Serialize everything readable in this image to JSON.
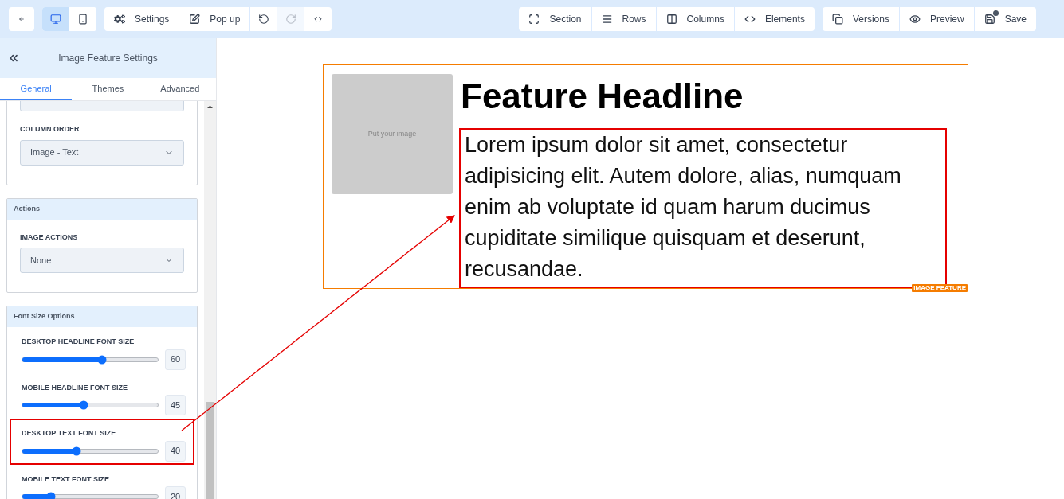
{
  "toolbar": {
    "devices": [
      {
        "selected": true
      },
      {
        "selected": false
      }
    ],
    "actions": [
      "Settings",
      "Pop up"
    ],
    "history": [
      {
        "disabled": false
      },
      {
        "disabled": true
      }
    ],
    "build": [
      "Section",
      "Rows",
      "Columns",
      "Elements"
    ],
    "publish": [
      "Versions",
      "Preview",
      "Save"
    ]
  },
  "sidebar": {
    "title": "Image Feature Settings",
    "tabs": [
      {
        "label": "General",
        "selected": true
      },
      {
        "label": "Themes",
        "selected": false
      },
      {
        "label": "Advanced",
        "selected": false
      }
    ],
    "sections": [
      {
        "fields": [
          {
            "kind": "stub"
          },
          {
            "kind": "select",
            "label": "COLUMN ORDER",
            "value": "Image - Text"
          }
        ]
      },
      {
        "title": "Actions",
        "fields": [
          {
            "kind": "select",
            "label": "IMAGE ACTIONS",
            "value": "None"
          }
        ]
      },
      {
        "title": "Font Size Options",
        "fields": [
          {
            "kind": "slider",
            "label": "DESKTOP HEADLINE FONT SIZE",
            "level": 0.59,
            "value": "60",
            "annotated": false
          },
          {
            "kind": "slider",
            "label": "MOBILE HEADLINE FONT SIZE",
            "level": 0.45,
            "value": "45",
            "annotated": false
          },
          {
            "kind": "slider",
            "label": "DESKTOP TEXT FONT SIZE",
            "level": 0.4,
            "value": "40",
            "annotated": true
          },
          {
            "kind": "slider",
            "label": "MOBILE TEXT FONT SIZE",
            "level": 0.21,
            "value": "20",
            "annotated": false
          }
        ]
      }
    ]
  },
  "canvas": {
    "image_placeholder": "Put your image",
    "headline": "Feature Headline",
    "body": {
      "text": "Lorem ipsum dolor sit amet, consectetur adipisicing elit. Autem dolore, alias, numquam enim ab voluptate id quam harum ducimus cupiditate similique quisquam et deserunt, recusandae.",
      "annotated": true
    },
    "badge": "IMAGE FEATURE"
  }
}
